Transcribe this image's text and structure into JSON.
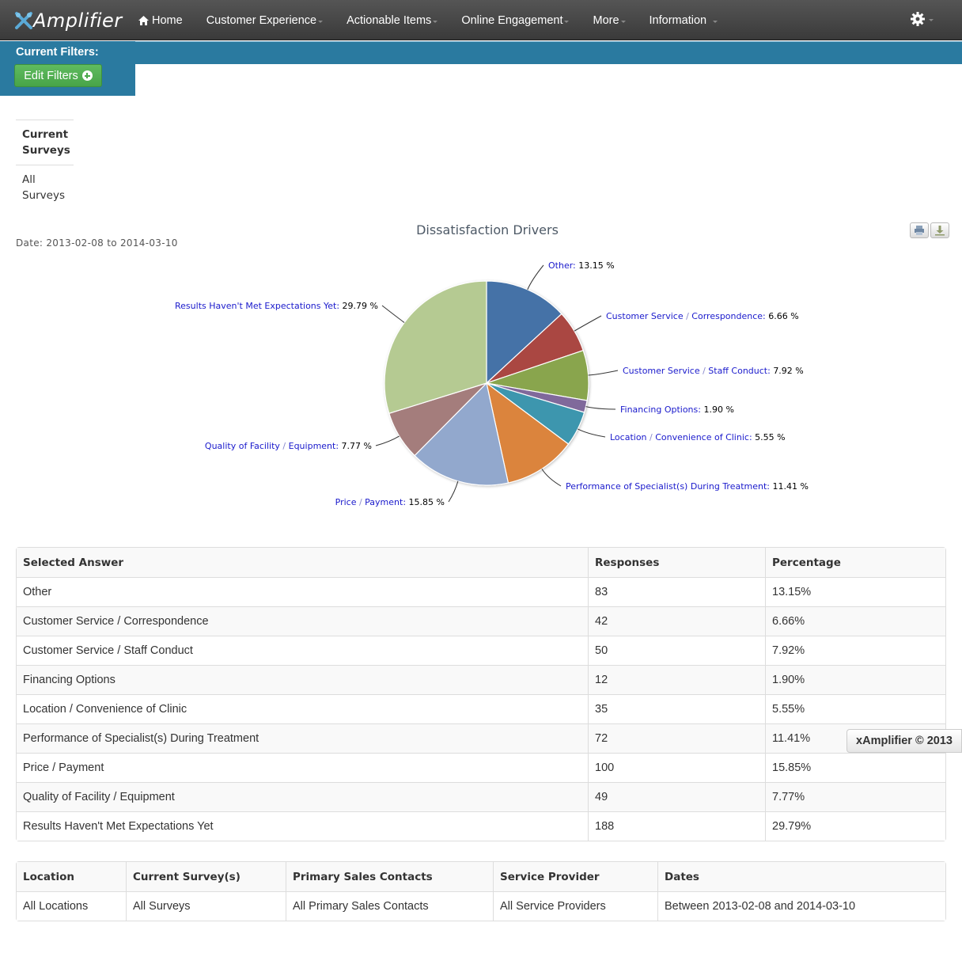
{
  "app": {
    "brand": "Amplifier",
    "nav": [
      {
        "label": "Home",
        "icon": "home-icon"
      },
      {
        "label": "Customer Experience",
        "dropdown": true
      },
      {
        "label": "Actionable Items",
        "dropdown": true
      },
      {
        "label": "Online Engagement",
        "dropdown": true
      },
      {
        "label": "More",
        "dropdown": true
      },
      {
        "label": "Information",
        "dropdown": true
      }
    ],
    "settings_icon": "gear-icon"
  },
  "filters": {
    "title": "Current Filters:",
    "edit_button": "Edit Filters",
    "edit_icon": "plus-circle-icon"
  },
  "surveys": {
    "header": "Current Surveys",
    "value": "All Surveys"
  },
  "chart_meta": {
    "date_label": "Date: 2013-02-08 to 2014-03-10",
    "print_icon": "print-icon",
    "download_icon": "download-icon"
  },
  "chart_data": {
    "type": "pie",
    "title": "Dissatisfaction Drivers",
    "unit": "%",
    "start_angle": "12 o'clock, clockwise",
    "slices": [
      {
        "label": "Other",
        "value": 13.15,
        "color": "#4572a7"
      },
      {
        "label": "Customer Service / Correspondence",
        "value": 6.66,
        "color": "#aa4643"
      },
      {
        "label": "Customer Service / Staff Conduct",
        "value": 7.92,
        "color": "#89a54e"
      },
      {
        "label": "Financing Options",
        "value": 1.9,
        "color": "#80699b"
      },
      {
        "label": "Location / Convenience of Clinic",
        "value": 5.55,
        "color": "#3d96ae"
      },
      {
        "label": "Performance of Specialist(s) During Treatment",
        "value": 11.41,
        "color": "#db843d"
      },
      {
        "label": "Price / Payment",
        "value": 15.85,
        "color": "#92a8cd"
      },
      {
        "label": "Quality of Facility / Equipment",
        "value": 7.77,
        "color": "#a47d7c"
      },
      {
        "label": "Results Haven't Met Expectations Yet",
        "value": 29.79,
        "color": "#b5ca92"
      }
    ],
    "label_color": "#1a1acc",
    "value_color": "#000000"
  },
  "results_table": {
    "headers": [
      "Selected Answer",
      "Responses",
      "Percentage"
    ],
    "rows": [
      [
        "Other",
        "83",
        "13.15%"
      ],
      [
        "Customer Service / Correspondence",
        "42",
        "6.66%"
      ],
      [
        "Customer Service / Staff Conduct",
        "50",
        "7.92%"
      ],
      [
        "Financing Options",
        "12",
        "1.90%"
      ],
      [
        "Location / Convenience of Clinic",
        "35",
        "5.55%"
      ],
      [
        "Performance of Specialist(s) During Treatment",
        "72",
        "11.41%"
      ],
      [
        "Price / Payment",
        "100",
        "15.85%"
      ],
      [
        "Quality of Facility / Equipment",
        "49",
        "7.77%"
      ],
      [
        "Results Haven't Met Expectations Yet",
        "188",
        "29.79%"
      ]
    ]
  },
  "filters_table": {
    "headers": [
      "Location",
      "Current Survey(s)",
      "Primary Sales Contacts",
      "Service Provider",
      "Dates"
    ],
    "rows": [
      [
        "All Locations",
        "All Surveys",
        "All Primary Sales Contacts",
        "All Service Providers",
        "Between 2013-02-08 and 2014-03-10"
      ]
    ]
  },
  "footer": {
    "copyright": "xAmplifier © 2013"
  }
}
